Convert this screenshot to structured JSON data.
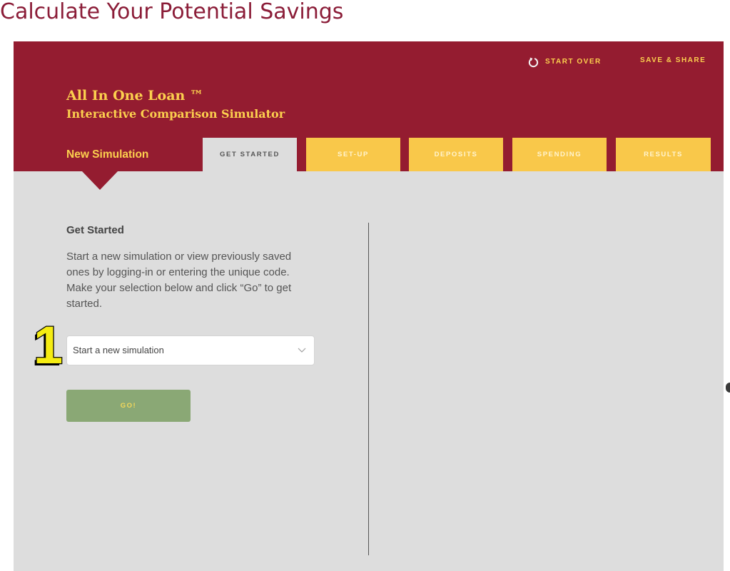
{
  "page": {
    "heading": "Calculate Your Potential Savings"
  },
  "header": {
    "start_over": {
      "icon": "refresh-icon",
      "label": "START OVER"
    },
    "save_share": {
      "label": "SAVE & SHARE"
    },
    "title": "All In One Loan ™",
    "subtitle": "Interactive Comparison Simulator",
    "current_section": "New Simulation"
  },
  "tabs": [
    {
      "label": "GET STARTED",
      "active": true
    },
    {
      "label": "SET-UP",
      "active": false
    },
    {
      "label": "DEPOSITS",
      "active": false
    },
    {
      "label": "SPENDING",
      "active": false
    },
    {
      "label": "RESULTS",
      "active": false
    }
  ],
  "get_started": {
    "heading": "Get Started",
    "description_lines": [
      "Start a new simulation or view previously saved",
      "ones by logging-in or entering the unique code.",
      "Make your selection below and click “Go” to get",
      "started."
    ],
    "simulation_select": {
      "selected": "Start a new simulation",
      "icon": "chevron-down-icon"
    },
    "go_button": {
      "label": "GO!"
    }
  },
  "annotation": {
    "step_number": "1"
  },
  "colors": {
    "brand_maroon": "#941c30",
    "heading_maroon": "#8b1d38",
    "tab_yellow": "#f9c84a",
    "header_text_yellow": "#fcd04e",
    "panel_grey": "#dddddd",
    "go_green": "#8aa875",
    "annotation_yellow": "#f5ec12"
  }
}
